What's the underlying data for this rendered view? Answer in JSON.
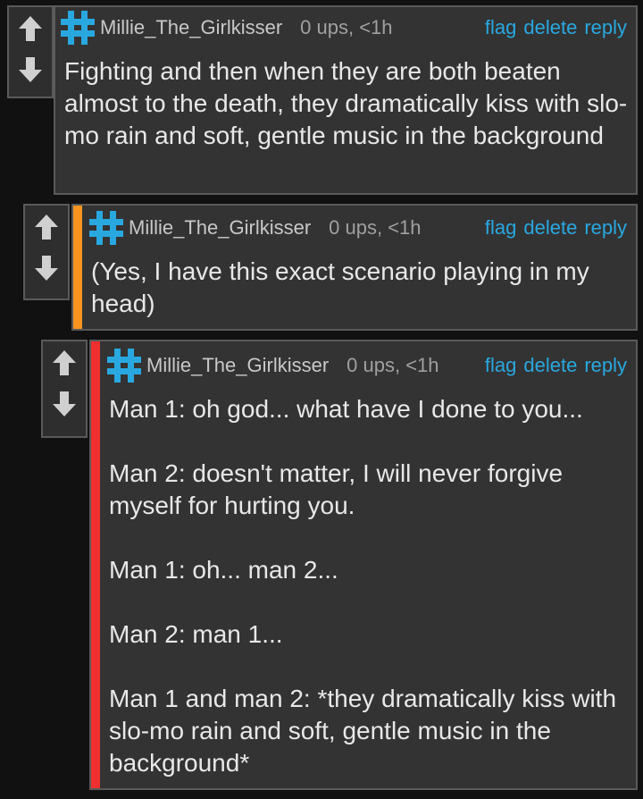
{
  "colors": {
    "background": "#111111",
    "panel": "#333333",
    "border": "#5a5a5a",
    "link": "#29a8e0",
    "hash_icon": "#29a8e0",
    "accent_level_1": "#f7931e",
    "accent_level_2": "#f03030"
  },
  "icons": {
    "upvote": "arrow-up-icon",
    "downvote": "arrow-down-icon",
    "avatar": "hash-icon"
  },
  "comments": [
    {
      "username": "Millie_The_Girlkisser",
      "meta": "0 ups, <1h",
      "actions": {
        "flag": "flag",
        "delete": "delete",
        "reply": "reply"
      },
      "text": "Fighting and then when they are both beaten almost to the death, they dramatically kiss with slo-mo rain and soft, gentle music in the background"
    },
    {
      "username": "Millie_The_Girlkisser",
      "meta": "0 ups, <1h",
      "actions": {
        "flag": "flag",
        "delete": "delete",
        "reply": "reply"
      },
      "text": "(Yes, I have this exact scenario playing in my head)"
    },
    {
      "username": "Millie_The_Girlkisser",
      "meta": "0 ups, <1h",
      "actions": {
        "flag": "flag",
        "delete": "delete",
        "reply": "reply"
      },
      "text": "Man 1: oh god... what have I done to you...\n\nMan 2: doesn't matter, I will never forgive myself for hurting you.\n\nMan 1: oh... man 2...\n\nMan 2: man 1...\n\nMan 1 and man 2: *they dramatically kiss with slo-mo rain and soft, gentle music in the background*"
    }
  ]
}
